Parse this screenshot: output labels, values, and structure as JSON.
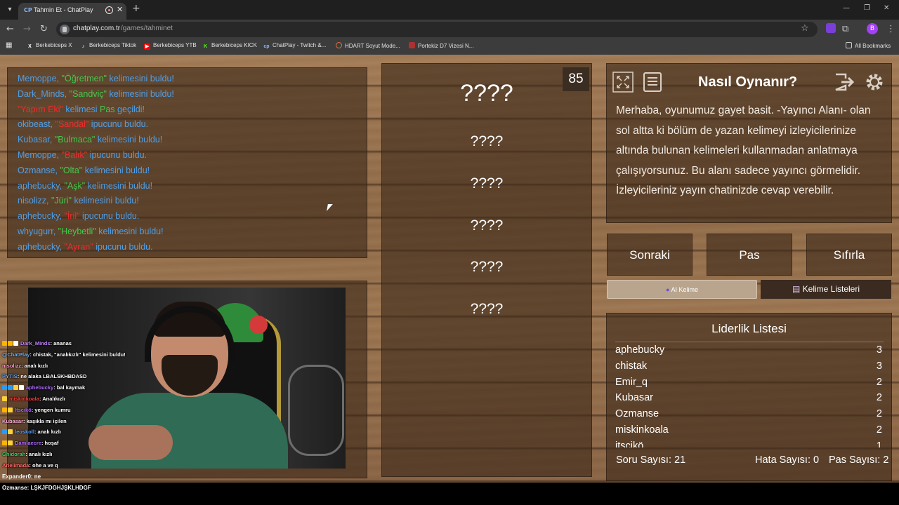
{
  "browser": {
    "tab_title": "Tahmin Et - ChatPlay",
    "tab_favicon": "CP",
    "url_host": "chatplay.com.tr",
    "url_path": "/games/tahminet",
    "profile_initial": "B",
    "bookmarks": [
      {
        "label": "Berkebiceps X",
        "icon": "x-icon",
        "color": "#ffffff"
      },
      {
        "label": "Berkebiceps Tiktok",
        "icon": "tiktok-icon",
        "color": "#ffffff"
      },
      {
        "label": "Berkebiceps YTB",
        "icon": "youtube-icon",
        "color": "#ff0000"
      },
      {
        "label": "Berkebiceps KICK",
        "icon": "kick-icon",
        "color": "#53fc18"
      },
      {
        "label": "ChatPlay - Twitch &...",
        "icon": "chatplay-icon",
        "color": "#8ab4f8"
      },
      {
        "label": "HDART Soyut Mode...",
        "icon": "hdart-icon",
        "color": "#e8703a"
      },
      {
        "label": "Portekiz D7 Vizesi N...",
        "icon": "bookmark-icon",
        "color": "#b03030"
      }
    ],
    "all_bookmarks": "All Bookmarks"
  },
  "log": [
    {
      "parts": [
        {
          "t": "Memoppe, ",
          "c": "blue"
        },
        {
          "t": "\"Öğretmen\"",
          "c": "green"
        },
        {
          "t": " kelimesini buldu!",
          "c": "blue"
        }
      ]
    },
    {
      "parts": [
        {
          "t": "Dark_Minds, ",
          "c": "blue"
        },
        {
          "t": "\"Sandviç\"",
          "c": "green"
        },
        {
          "t": " kelimesini buldu!",
          "c": "blue"
        }
      ]
    },
    {
      "parts": [
        {
          "t": "\"Yapım Eki\"",
          "c": "red"
        },
        {
          "t": " kelimesi ",
          "c": "blue"
        },
        {
          "t": "Pas",
          "c": "green"
        },
        {
          "t": " geçildi!",
          "c": "blue"
        }
      ]
    },
    {
      "parts": [
        {
          "t": "okibeast, ",
          "c": "blue"
        },
        {
          "t": "\"Sandal\"",
          "c": "red"
        },
        {
          "t": " ipucunu buldu.",
          "c": "blue"
        }
      ]
    },
    {
      "parts": [
        {
          "t": "Kubasar, ",
          "c": "blue"
        },
        {
          "t": "\"Bulmaca\"",
          "c": "green"
        },
        {
          "t": " kelimesini buldu!",
          "c": "blue"
        }
      ]
    },
    {
      "parts": [
        {
          "t": "Memoppe, ",
          "c": "blue"
        },
        {
          "t": "\"Balık\"",
          "c": "red"
        },
        {
          "t": " ipucunu buldu.",
          "c": "blue"
        }
      ]
    },
    {
      "parts": [
        {
          "t": "Ozmanse, ",
          "c": "blue"
        },
        {
          "t": "\"Olta\"",
          "c": "green"
        },
        {
          "t": " kelimesini buldu!",
          "c": "blue"
        }
      ]
    },
    {
      "parts": [
        {
          "t": "aphebucky, ",
          "c": "blue"
        },
        {
          "t": "\"Aşk\"",
          "c": "green"
        },
        {
          "t": " kelimesini buldu!",
          "c": "blue"
        }
      ]
    },
    {
      "parts": [
        {
          "t": "nisolizz, ",
          "c": "blue"
        },
        {
          "t": "\"Jüri\"",
          "c": "green"
        },
        {
          "t": " kelimesini buldu!",
          "c": "blue"
        }
      ]
    },
    {
      "parts": [
        {
          "t": "aphebucky, ",
          "c": "blue"
        },
        {
          "t": "\"İril\"",
          "c": "red"
        },
        {
          "t": " ipucunu buldu.",
          "c": "blue"
        }
      ]
    },
    {
      "parts": [
        {
          "t": "whyugurr, ",
          "c": "blue"
        },
        {
          "t": "\"Heybetli\"",
          "c": "green"
        },
        {
          "t": " kelimesini buldu!",
          "c": "blue"
        }
      ]
    },
    {
      "parts": [
        {
          "t": "aphebucky, ",
          "c": "blue"
        },
        {
          "t": "\"Ayran\"",
          "c": "red"
        },
        {
          "t": " ipucunu buldu.",
          "c": "blue"
        }
      ]
    }
  ],
  "chat": [
    {
      "user": "Dark_Minds",
      "ucolor": "#c583ff",
      "msg": ": ananas",
      "badges": [
        "#ffb400",
        "#ffb400",
        "#ffffff"
      ]
    },
    {
      "user": "@ChatPlay",
      "ucolor": "#6fb4ff",
      "msg": ": chistak, \"analıkızlı\" kelimesini buldu!",
      "badges": []
    },
    {
      "user": "nisolizz",
      "ucolor": "#ff9ad2",
      "msg": ": analı kızlı",
      "badges": []
    },
    {
      "user": "PYTIS",
      "ucolor": "#5fa8ff",
      "msg": ": ne alaka LBALSKHBDASD",
      "badges": []
    },
    {
      "user": "aphebucky",
      "ucolor": "#b06bff",
      "msg": ": bal kaymak",
      "badges": [
        "#2a9bf3",
        "#2a9bf3",
        "#ffd23a",
        "#ffffff"
      ]
    },
    {
      "user": "miskinkoala",
      "ucolor": "#ff3b3b",
      "msg": ": Analıkızlı",
      "badges": [
        "#ffd23a"
      ]
    },
    {
      "user": "Itscikö",
      "ucolor": "#b06bff",
      "msg": ": yengen kumru",
      "badges": [
        "#ffb400",
        "#ffd23a"
      ]
    },
    {
      "user": "Kubasar",
      "ucolor": "#ffb3d9",
      "msg": ": kaşıkla mı içilen",
      "badges": []
    },
    {
      "user": "leoskoll",
      "ucolor": "#5fa8ff",
      "msg": ": analı kızlı",
      "badges": [
        "#2a9bf3",
        "#ffd23a"
      ]
    },
    {
      "user": "Damlaecre",
      "ucolor": "#b06bff",
      "msg": ": hoşaf",
      "badges": [
        "#ffb400",
        "#ffd23a"
      ]
    },
    {
      "user": "Ghidorah",
      "ucolor": "#3bd36f",
      "msg": ": analı kızlı",
      "badges": []
    },
    {
      "user": "Arielimada",
      "ucolor": "#ff6b6b",
      "msg": ": ohe a ve q",
      "badges": []
    }
  ],
  "below_chat": [
    {
      "user": "Expander0",
      "msg": ": ne"
    },
    {
      "user": "Ozmanse",
      "msg": ": LŞKJFDGHJŞKLHDGF"
    }
  ],
  "timer": "85",
  "words": [
    "????",
    "????",
    "????",
    "????",
    "????",
    "????"
  ],
  "info": {
    "title": "Nasıl Oynanır?",
    "text": "Merhaba, oyunumuz gayet basit. -Yayıncı Alanı- olan sol altta ki bölüm de yazan kelimeyi izleyicilerinize altında bulunan kelimeleri kullanmadan anlatmaya çalışıyorsunuz. Bu alanı sadece yayıncı görmelidir. İzleyicileriniz yayın chatinizde cevap verebilir."
  },
  "actions": {
    "next": "Sonraki",
    "pass": "Pas",
    "reset": "Sıfırla"
  },
  "tabs": {
    "ai": "AI Kelime",
    "lists": "Kelime Listeleri"
  },
  "leaderboard": {
    "title": "Liderlik Listesi",
    "rows": [
      {
        "name": "aphebucky",
        "score": "3"
      },
      {
        "name": "chistak",
        "score": "3"
      },
      {
        "name": "Emir_q",
        "score": "2"
      },
      {
        "name": "Kubasar",
        "score": "2"
      },
      {
        "name": "Ozmanse",
        "score": "2"
      },
      {
        "name": "miskinkoala",
        "score": "2"
      },
      {
        "name": "itscikö",
        "score": "1"
      }
    ]
  },
  "stats": {
    "questions": "Soru Sayısı: 21",
    "errors": "Hata Sayısı: 0",
    "passes": "Pas Sayısı: 2"
  },
  "colors": {
    "blue": "#4f9fe8",
    "green": "#42c94d",
    "red": "#ee2c2c"
  }
}
